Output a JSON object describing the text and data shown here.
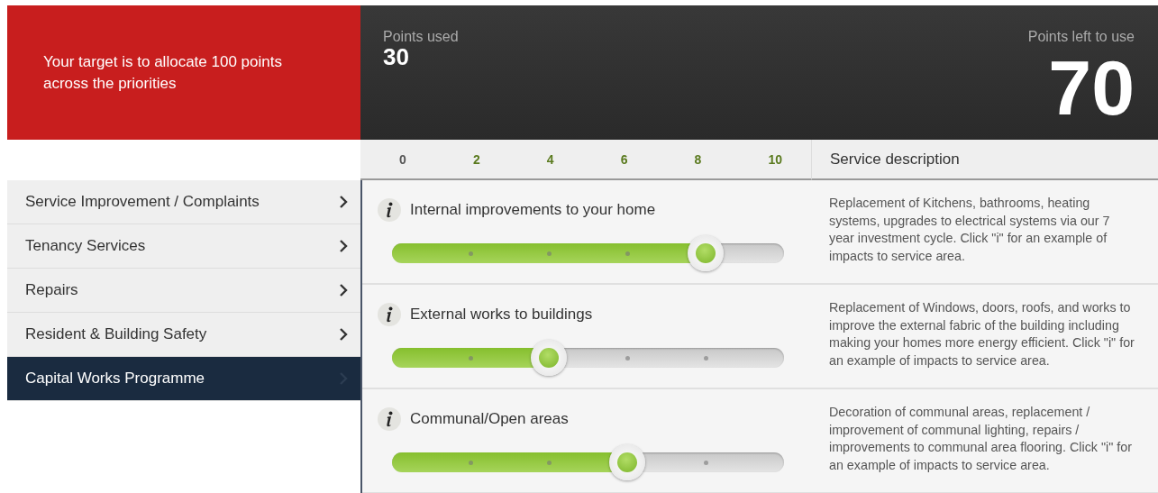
{
  "target_message": "Your target is to allocate 100 points across the priorities",
  "points_used": {
    "label": "Points used",
    "value": "30"
  },
  "points_left": {
    "label": "Points left to use",
    "value": "70"
  },
  "scale": [
    "0",
    "2",
    "4",
    "6",
    "8",
    "10"
  ],
  "description_heading": "Service description",
  "sidebar": {
    "items": [
      {
        "label": "Service Improvement / Complaints",
        "selected": false
      },
      {
        "label": "Tenancy Services",
        "selected": false
      },
      {
        "label": "Repairs",
        "selected": false
      },
      {
        "label": "Resident & Building Safety",
        "selected": false
      },
      {
        "label": "Capital Works Programme",
        "selected": true
      }
    ]
  },
  "priorities": [
    {
      "title": "Internal improvements to your home",
      "level": 0.8,
      "description": "Replacement of Kitchens, bathrooms, heating systems, upgrades to electrical systems via our 7 year investment cycle. Click \"i\" for an example of impacts to service area."
    },
    {
      "title": "External works to buildings",
      "level": 0.4,
      "description": "Replacement of Windows, doors, roofs, and works to improve the external fabric of the building including making your homes more energy efficient. Click \"i\" for an example of impacts to service area."
    },
    {
      "title": "Communal/Open areas",
      "level": 0.6,
      "description": "Decoration of communal areas, replacement / improvement of communal lighting, repairs / improvements to communal area flooring. Click \"i\" for an example of impacts to service area."
    }
  ]
}
